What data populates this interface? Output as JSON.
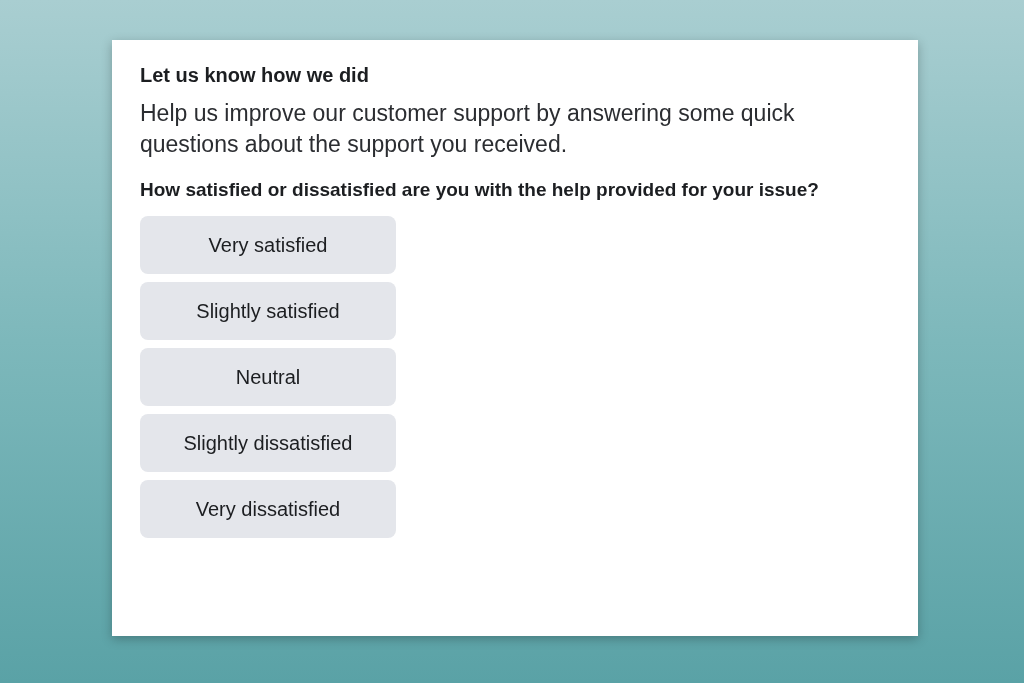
{
  "card": {
    "title": "Let us know how we did",
    "intro": "Help us improve our customer support by answering some quick questions about the support you received.",
    "question": "How satisfied or dissatisfied are you with the help provided for your issue?",
    "options": [
      {
        "label": "Very satisfied"
      },
      {
        "label": "Slightly satisfied"
      },
      {
        "label": "Neutral"
      },
      {
        "label": "Slightly dissatisfied"
      },
      {
        "label": "Very dissatisfied"
      }
    ]
  }
}
